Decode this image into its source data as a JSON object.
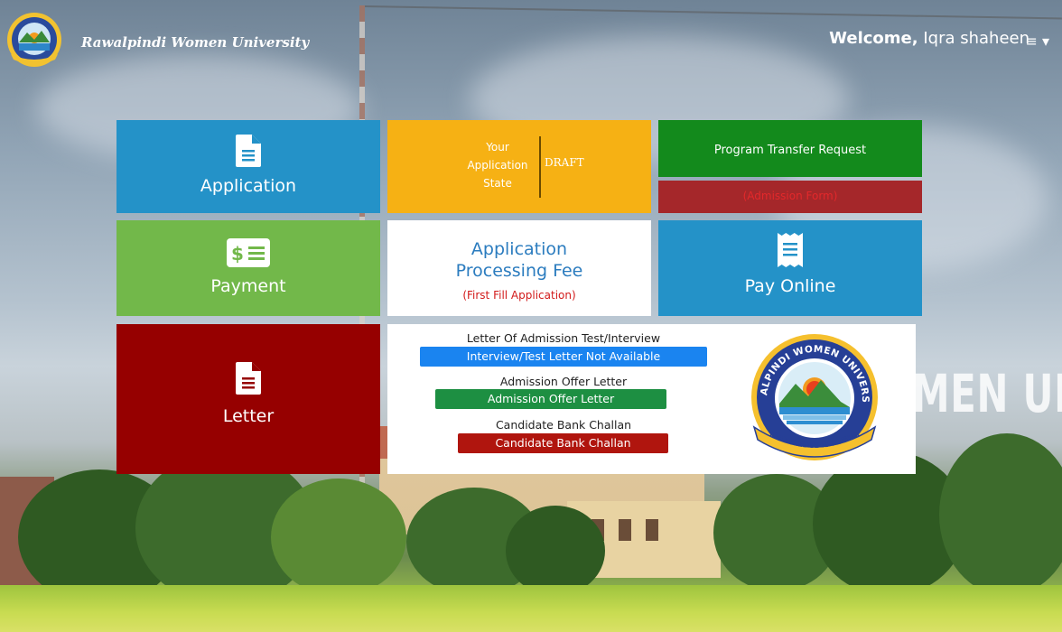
{
  "header": {
    "brand_name": "Rawalpindi Women University",
    "welcome_prefix": "Welcome,",
    "user_name": "Iqra shaheen",
    "menu_icon": "hamburger-menu-icon"
  },
  "background": {
    "caption_text": "MEN UN"
  },
  "tiles": {
    "application": {
      "label": "Application",
      "icon": "document-icon"
    },
    "application_state": {
      "label_line1": "Your",
      "label_line2": "Application",
      "label_line3": "State",
      "value": "DRAFT"
    },
    "program_transfer": {
      "label": "Program Transfer Request"
    },
    "admission_form": {
      "label": "(Admission Form)"
    },
    "payment": {
      "label": "Payment",
      "icon": "payment-icon"
    },
    "processing_fee": {
      "title_line1": "Application",
      "title_line2": "Processing Fee",
      "note": "(First Fill Application)"
    },
    "pay_online": {
      "label": "Pay Online",
      "icon": "receipt-icon"
    },
    "letter": {
      "label": "Letter",
      "icon": "document-icon"
    }
  },
  "letters": {
    "test_heading": "Letter Of Admission Test/Interview",
    "test_button": "Interview/Test Letter Not Available",
    "offer_heading": "Admission Offer Letter",
    "offer_button": "Admission Offer Letter",
    "challan_heading": "Candidate Bank Challan",
    "challan_button": "Candidate Bank Challan"
  },
  "seal": {
    "top_text": "RAWALPINDI WOMEN UNIVERSITY",
    "motto": "KNOWLEDGE IS POWER"
  },
  "colors": {
    "blue_tile": "#2492c8",
    "yellow_tile": "#f6b114",
    "green_tile": "#138a1c",
    "red_tile": "#a5272a",
    "payment_tile": "#72b84a",
    "letter_tile": "#960000"
  }
}
